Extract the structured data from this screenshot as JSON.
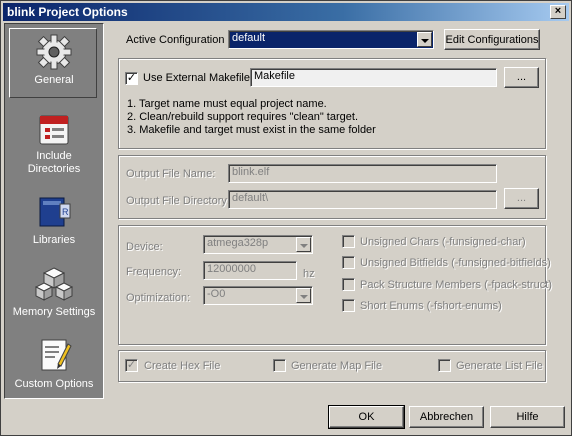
{
  "window": {
    "title": "blink Project Options",
    "close_label": "×"
  },
  "sidebar": {
    "items": [
      {
        "label": "General",
        "icon": "gear-icon"
      },
      {
        "label": "Include Directories",
        "label_line1": "Include",
        "label_line2": "Directories",
        "icon": "include-directories-icon"
      },
      {
        "label": "Libraries",
        "icon": "libraries-icon"
      },
      {
        "label": "Memory Settings",
        "icon": "memory-settings-icon"
      },
      {
        "label": "Custom Options",
        "icon": "custom-options-icon"
      }
    ]
  },
  "config": {
    "active_label": "Active Configuration",
    "active_value": "default",
    "edit_button": "Edit Configurations"
  },
  "makefile": {
    "checkbox_label": "Use External Makefile",
    "checked": true,
    "value": "Makefile",
    "browse_label": "...",
    "notes": [
      "1. Target name must equal project name.",
      "2. Clean/rebuild support requires \"clean\" target.",
      "3. Makefile and target must exist in the same folder"
    ]
  },
  "output": {
    "file_name_label": "Output File Name:",
    "file_name_value": "blink.elf",
    "directory_label": "Output File Directory:",
    "directory_value": "default\\",
    "browse_label": "..."
  },
  "device": {
    "device_label": "Device:",
    "device_value": "atmega328p",
    "frequency_label": "Frequency:",
    "frequency_value": "12000000",
    "frequency_unit": "hz",
    "optimization_label": "Optimization:",
    "optimization_value": "-O0",
    "options": [
      "Unsigned Chars (-funsigned-char)",
      "Unsigned Bitfields (-funsigned-bitfields)",
      "Pack Structure Members (-fpack-struct)",
      "Short Enums (-fshort-enums)"
    ]
  },
  "files": {
    "hex": "Create Hex File",
    "map": "Generate Map File",
    "list": "Generate List File"
  },
  "buttons": {
    "ok": "OK",
    "cancel": "Abbrechen",
    "help": "Hilfe"
  }
}
